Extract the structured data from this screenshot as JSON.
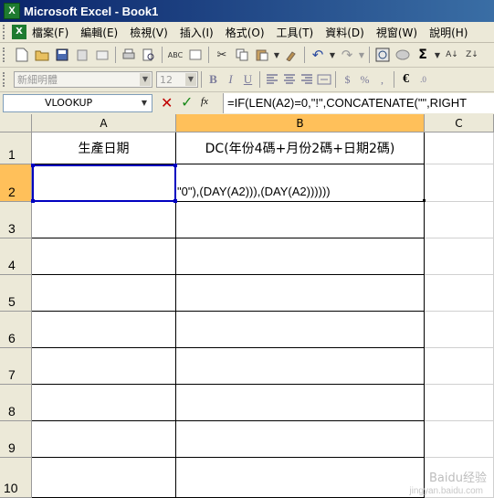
{
  "window": {
    "title": "Microsoft Excel - Book1"
  },
  "menu": [
    "檔案(F)",
    "編輯(E)",
    "檢視(V)",
    "插入(I)",
    "格式(O)",
    "工具(T)",
    "資料(D)",
    "視窗(W)",
    "說明(H)"
  ],
  "toolbar": {
    "font_name": "新細明體",
    "font_size": "12"
  },
  "formula_bar": {
    "name_box": "VLOOKUP",
    "fx": "fx",
    "formula": "=IF(LEN(A2)=0,\"!\",CONCATENATE(\"\",RIGHT"
  },
  "columns": [
    "A",
    "B",
    "C"
  ],
  "rows": [
    "1",
    "2",
    "3",
    "4",
    "5",
    "6",
    "7",
    "8",
    "9",
    "10"
  ],
  "cells": {
    "A1": "生產日期",
    "B1": "DC(年份4碼+月份2碼+日期2碼)",
    "B2_edit": "\"0\"),(DAY(A2))),(DAY(A2))))))"
  },
  "watermark": {
    "main": "Baidu经验",
    "sub": "jingyan.baidu.com"
  },
  "colors": {
    "title_bar": "#0a246a",
    "active_header": "#ffc05a",
    "selection": "#0000c0"
  }
}
